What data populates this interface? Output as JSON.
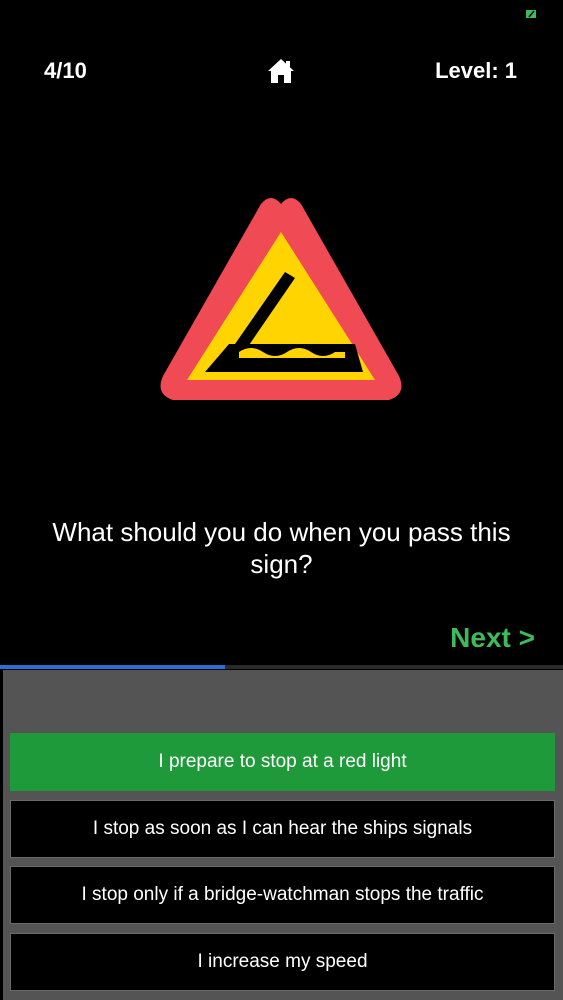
{
  "status": {
    "icon": "battery-icon",
    "color": "#3dbb5b"
  },
  "header": {
    "progress": "4/10",
    "home_icon": "home-icon",
    "level": "Level: 1"
  },
  "sign": {
    "icon": "opening-bridge-warning-sign",
    "colors": {
      "border": "#f04a55",
      "fill": "#ffd400",
      "symbol": "#000000"
    }
  },
  "question": "What should you do when you pass this sign?",
  "next_label": "Next >",
  "quiz_progress": {
    "fraction": 0.4,
    "color": "#2a6fd8"
  },
  "answers": [
    {
      "label": "I prepare to stop at a red light",
      "selected": true
    },
    {
      "label": "I stop as soon as I can hear the ships signals",
      "selected": false
    },
    {
      "label": "I stop only if a bridge-watchman stops the traffic",
      "selected": false
    },
    {
      "label": "I increase my speed",
      "selected": false
    }
  ],
  "colors": {
    "accent_green": "#3dbb5b",
    "selected_answer": "#1f9a3a",
    "panel": "#545454"
  }
}
